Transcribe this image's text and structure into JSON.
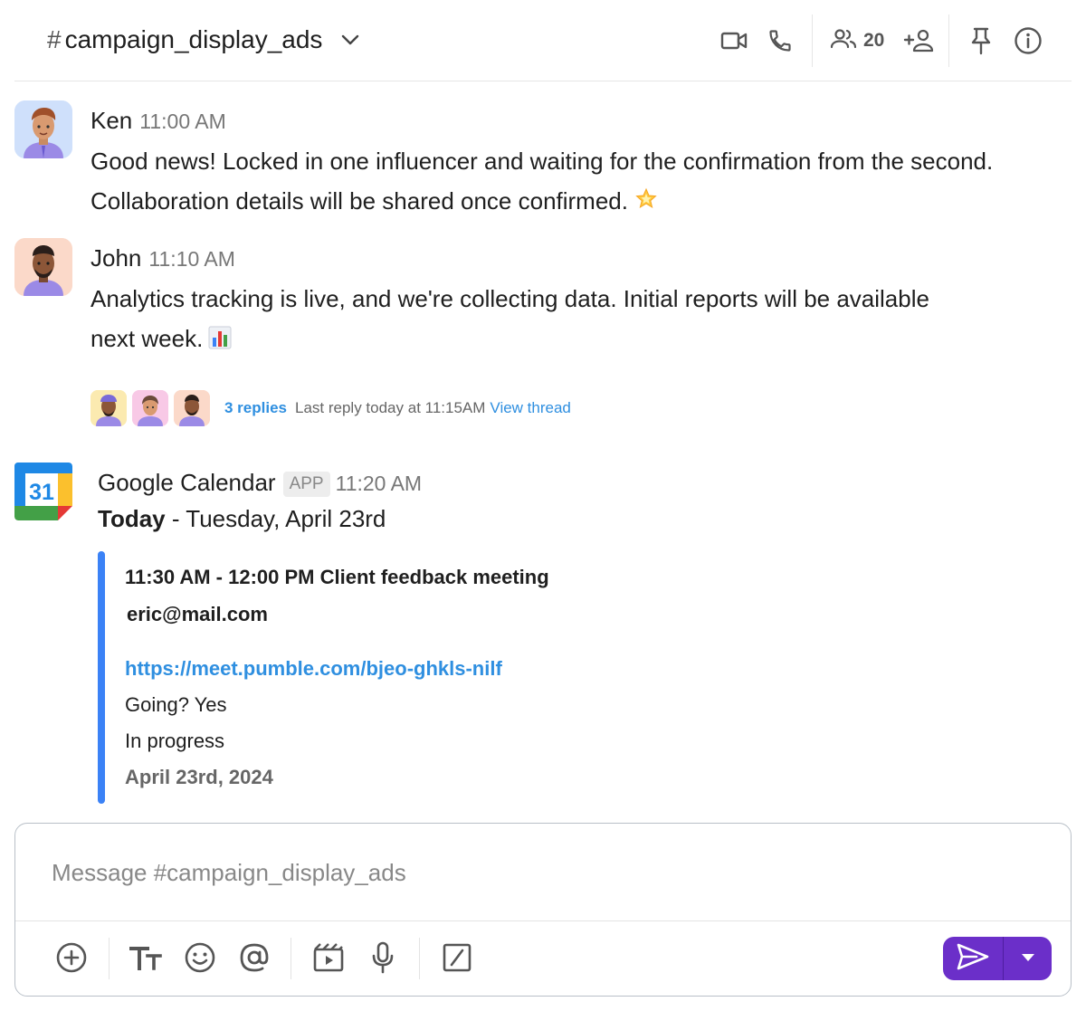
{
  "header": {
    "channel_hash": "#",
    "channel_name": "campaign_display_ads",
    "member_count": "20",
    "icons": [
      "chevron-down-icon",
      "video-icon",
      "phone-icon",
      "members-icon",
      "add-member-icon",
      "pin-icon",
      "info-icon"
    ]
  },
  "messages": [
    {
      "author": "Ken",
      "time": "11:00 AM",
      "lines": [
        "Good news! Locked in one influencer and waiting for the confirmation from the second.",
        "Collaboration details will be shared once confirmed."
      ],
      "emoji": "glowing-star"
    },
    {
      "author": "John",
      "time": "11:10 AM",
      "lines": [
        "Analytics tracking is live, and we're collecting data. Initial reports will be available",
        "next week."
      ],
      "emoji": "bar-chart",
      "thread": {
        "replies": "3 replies",
        "last_reply": "Last reply today at 11:15AM",
        "view": "View thread"
      }
    }
  ],
  "app_message": {
    "author": "Google Calendar",
    "badge": "APP",
    "time": "11:20 AM",
    "calendar_day": "31",
    "today_label": "Today",
    "today_rest": " - Tuesday, April 23rd",
    "event": {
      "title": "11:30 AM - 12:00 PM Client feedback meeting",
      "organizer": "eric@mail.com",
      "link": "https://meet.pumble.com/bjeo-ghkls-nilf",
      "going": "Going? Yes",
      "status": "In progress",
      "date": "April 23rd, 2024"
    }
  },
  "composer": {
    "placeholder": "Message #campaign_display_ads",
    "tools": [
      "add-icon",
      "text-format-icon",
      "emoji-icon",
      "mention-icon",
      "video-clip-icon",
      "mic-icon",
      "slash-command-icon"
    ]
  },
  "colors": {
    "accent": "#6b2fc9",
    "link": "#2f8fe0",
    "card_bar": "#3b82f6"
  }
}
